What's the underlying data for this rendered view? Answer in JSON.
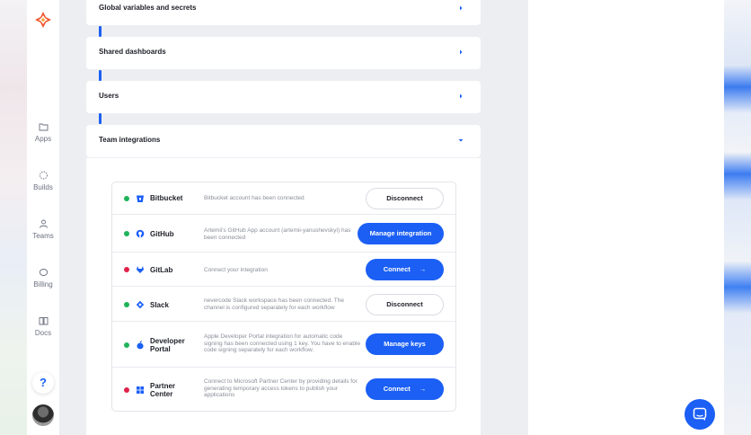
{
  "sidebar": {
    "items": [
      {
        "label": "Apps",
        "icon": "folder-icon"
      },
      {
        "label": "Builds",
        "icon": "builds-icon"
      },
      {
        "label": "Teams",
        "icon": "user-icon"
      },
      {
        "label": "Billing",
        "icon": "billing-icon"
      },
      {
        "label": "Docs",
        "icon": "book-icon"
      }
    ],
    "help_label": "?"
  },
  "sections": [
    {
      "title": "Global variables and secrets",
      "expanded": false
    },
    {
      "title": "Shared dashboards",
      "expanded": false
    },
    {
      "title": "Users",
      "expanded": false
    },
    {
      "title": "Team integrations",
      "expanded": true
    }
  ],
  "integrations": [
    {
      "name": "Bitbucket",
      "status": "connected",
      "description": "Bitbucket account has been connected",
      "action": "Disconnect",
      "action_style": "outline",
      "icon": "bitbucket-icon"
    },
    {
      "name": "GitHub",
      "status": "connected",
      "description": "Artemii's GitHub App account (artemii-yanushevskyi) has been connected",
      "action": "Manage integration",
      "action_style": "primary",
      "icon": "github-icon"
    },
    {
      "name": "GitLab",
      "status": "disconnected",
      "description": "Connect your integration",
      "action": "Connect",
      "action_style": "primary-arrow",
      "icon": "gitlab-icon"
    },
    {
      "name": "Slack",
      "status": "connected",
      "description": "nevercode Slack workspace has been connected. The channel is configured separately for each workflow",
      "action": "Disconnect",
      "action_style": "outline",
      "icon": "slack-icon"
    },
    {
      "name": "Developer Portal",
      "status": "connected",
      "description": "Apple Developer Portal integration for automatic code signing has been connected using 1 key. You have to enable code signing separately for each workflow.",
      "action": "Manage keys",
      "action_style": "primary",
      "icon": "apple-icon"
    },
    {
      "name": "Partner Center",
      "status": "disconnected",
      "description": "Connect to Microsoft Partner Center by providing details for generating temporary access tokens to publish your applications",
      "action": "Connect",
      "action_style": "primary-arrow",
      "icon": "microsoft-icon"
    }
  ],
  "colors": {
    "accent": "#1b5ff5",
    "connected": "#1fb35a",
    "disconnected": "#e0234a"
  }
}
